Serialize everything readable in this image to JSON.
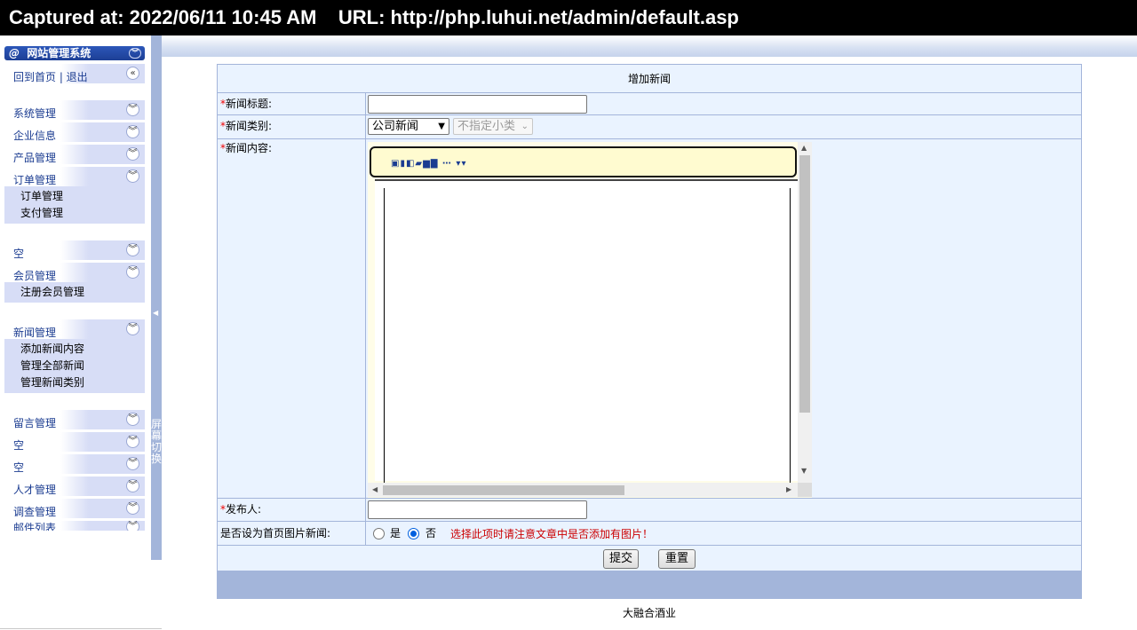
{
  "capture": {
    "text": "Captured at: 2022/06/11 10:45 AM    URL: http://php.luhui.net/admin/default.asp"
  },
  "sidebar": {
    "system_title": "网站管理系统",
    "home_logout": "回到首页 | 退出",
    "menus": [
      {
        "label": "系统管理"
      },
      {
        "label": "企业信息"
      },
      {
        "label": "产品管理"
      },
      {
        "label": "订单管理",
        "items": [
          "订单管理",
          "支付管理"
        ]
      },
      {
        "label": "空"
      },
      {
        "label": "会员管理",
        "items": [
          "注册会员管理"
        ]
      },
      {
        "label": "新闻管理",
        "items": [
          "添加新闻内容",
          "管理全部新闻",
          "管理新闻类别"
        ]
      },
      {
        "label": "留言管理"
      },
      {
        "label": "空"
      },
      {
        "label": "空"
      },
      {
        "label": "人才管理"
      },
      {
        "label": "调查管理"
      },
      {
        "label": "邮件列表"
      }
    ],
    "screen_switch": "屏幕切换"
  },
  "form": {
    "title": "增加新闻",
    "required_mark": "*",
    "fields": {
      "news_title": {
        "label": "新闻标题:",
        "value": ""
      },
      "news_type": {
        "label": "新闻类别:",
        "selected": "公司新闻",
        "sub_selected": "不指定小类"
      },
      "news_content": {
        "label": "新闻内容:"
      },
      "author": {
        "label": "发布人:",
        "value": ""
      },
      "home_image": {
        "label": "是否设为首页图片新闻:",
        "yes": "是",
        "no": "否",
        "selected": "否",
        "note": "选择此项时请注意文章中是否添加有图片！"
      }
    },
    "buttons": {
      "submit": "提交",
      "reset": "重置"
    }
  },
  "footer": {
    "company": "大融合酒业"
  },
  "colors": {
    "accent_blue": "#a3b5da",
    "sidebar_sub_bg": "#d7ddf6",
    "title_bar": "#2c57b9",
    "form_bg": "#eaf3ff",
    "note_red": "#cc0000"
  }
}
